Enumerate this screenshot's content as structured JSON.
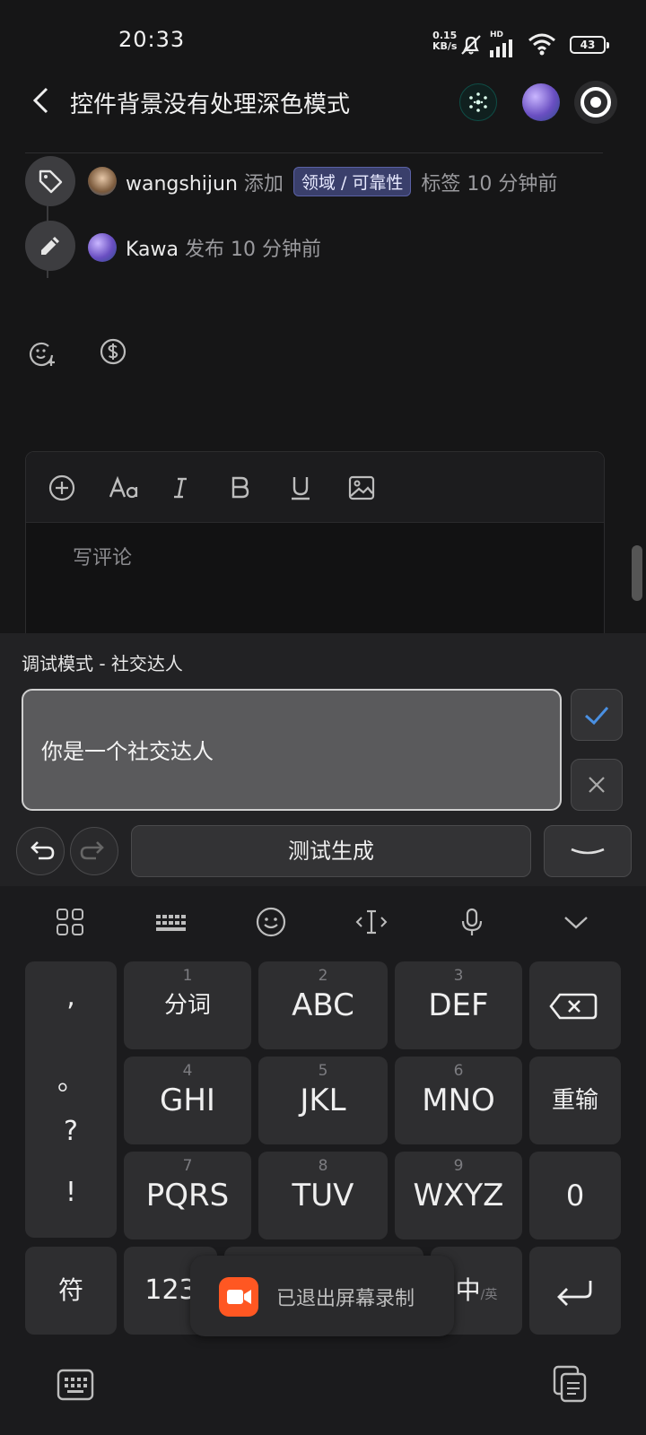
{
  "status_bar": {
    "time": "20:33",
    "net_speed_value": "0.15",
    "net_speed_unit": "KB/s",
    "signal_label": "HD",
    "battery": "43"
  },
  "header": {
    "title": "控件背景没有处理深色模式"
  },
  "timeline": {
    "event1": {
      "user": "wangshijun",
      "action": "添加",
      "tag": "领域 / 可靠性",
      "suffix": "标签 10 分钟前"
    },
    "event2": {
      "user": "Kawa",
      "action": "发布 10 分钟前"
    }
  },
  "editor": {
    "placeholder": "写评论"
  },
  "debug": {
    "title": "调试模式 - 社交达人",
    "input_value": "你是一个社交达人",
    "test_button": "测试生成"
  },
  "keyboard": {
    "punct": [
      ",",
      "。",
      "?",
      "!"
    ],
    "keys": [
      {
        "num": "1",
        "label": "分词"
      },
      {
        "num": "2",
        "label": "ABC"
      },
      {
        "num": "3",
        "label": "DEF"
      },
      {
        "num": "4",
        "label": "GHI"
      },
      {
        "num": "5",
        "label": "JKL"
      },
      {
        "num": "6",
        "label": "MNO"
      },
      {
        "num": "7",
        "label": "PQRS"
      },
      {
        "num": "8",
        "label": "TUV"
      },
      {
        "num": "9",
        "label": "WXYZ"
      }
    ],
    "reinput": "重输",
    "zero": "0",
    "symbols": "符",
    "numbers": "123",
    "lang_main": "中",
    "lang_alt": "/英"
  },
  "toast": {
    "text": "已退出屏幕录制"
  },
  "colors": {
    "background": "#161617",
    "tag_bg": "#3a3f6b",
    "accent_check": "#4a90e2",
    "toast_icon": "#ff5722"
  }
}
